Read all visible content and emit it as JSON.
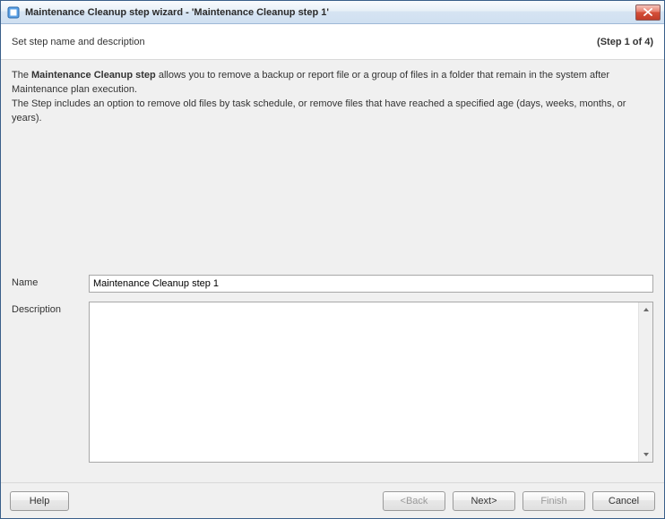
{
  "window": {
    "title": "Maintenance Cleanup step wizard - 'Maintenance Cleanup step 1'"
  },
  "header": {
    "subtitle": "Set step name and description",
    "step_info": "(Step 1 of 4)"
  },
  "intro": {
    "prefix": "The ",
    "bold": "Maintenance Cleanup step",
    "rest1": " allows you to remove a backup or report file or a group of files in a folder that remain in the system after Maintenance plan execution.",
    "line2": "The Step includes an option to remove old files by task schedule, or remove files that have reached a specified age  (days, weeks, months, or years)."
  },
  "form": {
    "name_label": "Name",
    "name_value": "Maintenance Cleanup step 1",
    "description_label": "Description",
    "description_value": ""
  },
  "footer": {
    "help": "Help",
    "back": "<Back",
    "next": "Next>",
    "finish": "Finish",
    "cancel": "Cancel"
  }
}
